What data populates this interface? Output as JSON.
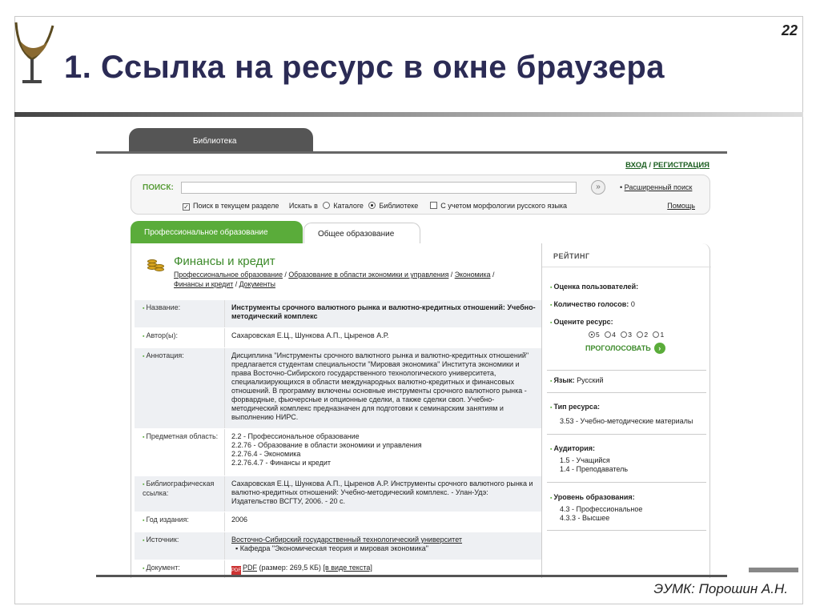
{
  "slide": {
    "number": "22",
    "title": "1. Ссылка на ресурс в окне браузера",
    "footer": "ЭУМК: Порошин А.Н."
  },
  "site": {
    "tab_library": "Библиотека",
    "login": "ВХОД",
    "login_sep": " / ",
    "register": "РЕГИСТРАЦИЯ",
    "search": {
      "label": "ПОИСК:",
      "value": "",
      "advanced": "Расширенный поиск",
      "in_section": "Поиск в текущем разделе",
      "search_in": "Искать в",
      "catalog": "Каталоге",
      "library": "Библиотеке",
      "morph": "С учетом морфологии русского языка",
      "help": "Помощь"
    },
    "tabs": [
      "Профессиональное образование",
      "Общее образование"
    ],
    "heading": "Финансы и кредит",
    "breadcrumbs": [
      "Профессиональное образование",
      "Образование в области экономики и управления",
      "Экономика",
      "Финансы и кредит",
      "Документы"
    ],
    "fields": [
      {
        "key": "Название:",
        "value": "Инструменты срочного валютного рынка и валютно-кредитных отношений: Учебно-методический комплекс"
      },
      {
        "key": "Автор(ы):",
        "value": "Сахаровская Е.Ц., Шункова А.П., Цыренов А.Р."
      },
      {
        "key": "Аннотация:",
        "value": "Дисциплина \"Инструменты срочного валютного рынка и валютно-кредитных отношений\" предлагается студентам специальности \"Мировая экономика\" Института экономики и права Восточно-Сибирского государственного технологического университета, специализирующихся в области международных валютно-кредитных и финансовых отношений. В программу включены основные инструменты срочного валютного рынка - форвардные, фьючерсные и опционные сделки, а также сделки своп. Учебно-методический комплекс предназначен для подготовки к семинарским занятиям и выполнению НИРС."
      },
      {
        "key": "Предметная область:",
        "value": "2.2 - Профессиональное образование\n2.2.76 - Образование в области экономики и управления\n2.2.76.4 - Экономика\n2.2.76.4.7 - Финансы и кредит"
      },
      {
        "key": "Библиографическая ссылка:",
        "value": "Сахаровская Е.Ц., Шункова А.П., Цыренов А.Р. Инструменты срочного валютного рынка и валютно-кредитных отношений: Учебно-методический комплекс. - Улан-Удэ: Издательство ВСГТУ, 2006. - 20 с."
      },
      {
        "key": "Год издания:",
        "value": "2006"
      },
      {
        "key": "Источник:",
        "value": "Восточно-Сибирский государственный технологический университет",
        "sub": "Кафедра \"Экономическая теория и мировая экономика\""
      },
      {
        "key": "Документ:",
        "value": "PDF",
        "size": "(размер: 269,5 КБ)",
        "text_link": "[в виде текста]"
      }
    ],
    "rating": {
      "header": "РЕЙТИНГ",
      "users_rating": "Оценка пользователей:",
      "votes_label": "Количество голосов:",
      "votes": "0",
      "rate": "Оцените ресурс:",
      "stars": [
        "5",
        "4",
        "3",
        "2",
        "1"
      ],
      "vote_btn": "ПРОГОЛОСОВАТЬ",
      "lang_label": "Язык:",
      "lang": "Русский",
      "type_label": "Тип ресурса:",
      "type": "3.53 - Учебно-методические материалы",
      "audience_label": "Аудитория:",
      "audience": [
        "1.5 - Учащийся",
        "1.4 - Преподаватель"
      ],
      "level_label": "Уровень образования:",
      "level": [
        "4.3 - Профессиональное",
        "4.3.3 - Высшее"
      ]
    }
  }
}
